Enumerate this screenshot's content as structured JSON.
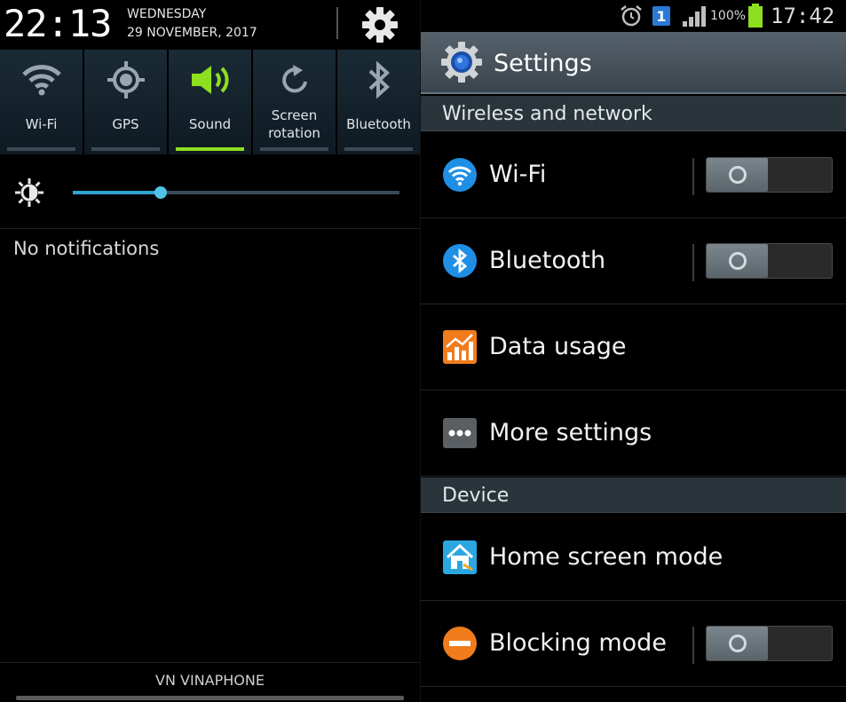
{
  "notification_panel": {
    "clock": "22:13",
    "day": "WEDNESDAY",
    "date": "29 NOVEMBER, 2017",
    "settings_icon": "gear-icon",
    "quick_settings": [
      {
        "label": "Wi-Fi",
        "icon": "wifi-icon",
        "on": false
      },
      {
        "label": "GPS",
        "icon": "gps-icon",
        "on": false
      },
      {
        "label": "Sound",
        "icon": "speaker-icon",
        "on": true
      },
      {
        "label": "Screen rotation",
        "icon": "rotation-icon",
        "on": false
      },
      {
        "label": "Bluetooth",
        "icon": "bluetooth-icon",
        "on": false
      }
    ],
    "brightness_level": 0.27,
    "no_notifications": "No notifications",
    "carrier": "VN VINAPHONE",
    "colors": {
      "active": "#8ddf1f",
      "slider": "#2fa4d0"
    }
  },
  "status_bar": {
    "sim_number": "1",
    "battery_percent": "100%",
    "time": "17:42"
  },
  "settings": {
    "title": "Settings",
    "sections": [
      {
        "header": "Wireless and network",
        "items": [
          {
            "label": "Wi-Fi",
            "icon": "wifi-icon",
            "toggle": "off"
          },
          {
            "label": "Bluetooth",
            "icon": "bluetooth-icon",
            "toggle": "off"
          },
          {
            "label": "Data usage",
            "icon": "data-usage-icon"
          },
          {
            "label": "More settings",
            "icon": "more-dots-icon"
          }
        ]
      },
      {
        "header": "Device",
        "items": [
          {
            "label": "Home screen mode",
            "icon": "home-icon"
          },
          {
            "label": "Blocking mode",
            "icon": "blocking-icon",
            "toggle": "off"
          }
        ]
      }
    ]
  }
}
